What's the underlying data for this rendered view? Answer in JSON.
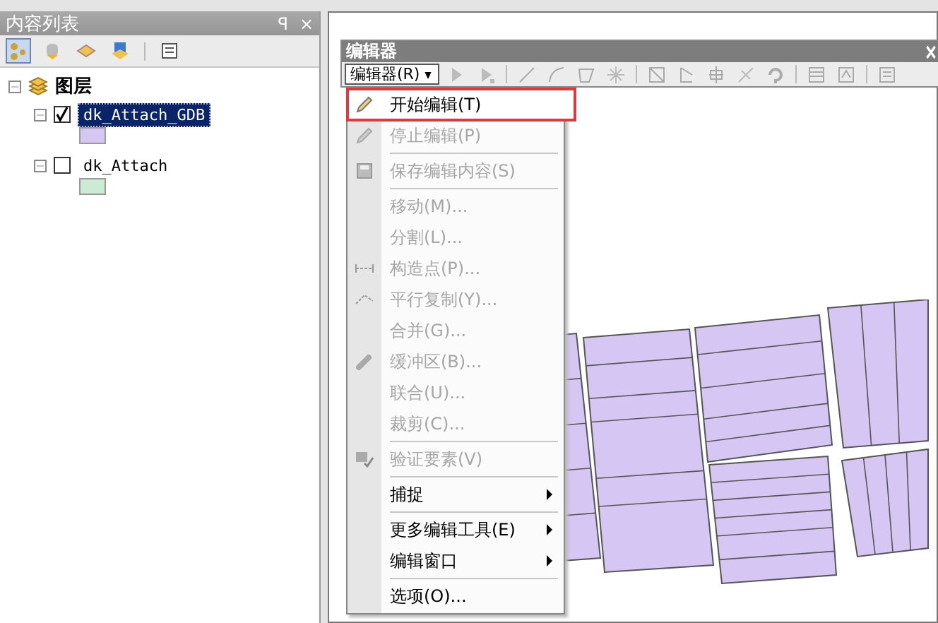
{
  "toc_panel": {
    "title": "内容列表",
    "pin": "ꟼ",
    "close": "×"
  },
  "layer_tree": {
    "label": "图层",
    "expanded": true,
    "children": [
      {
        "label": "dk_Attach_GDB",
        "checked": true,
        "selected": true,
        "expanded": true,
        "color": "#d6c6f2"
      },
      {
        "label": "dk_Attach",
        "checked": false,
        "selected": false,
        "expanded": true,
        "color": "#cdebd4"
      }
    ]
  },
  "editor_toolbar": {
    "title": "编辑器",
    "menu_button": "编辑器(R)"
  },
  "editor_menu": [
    {
      "kind": "item",
      "label": "开始编辑(T)",
      "disabled": false,
      "highlighted": true
    },
    {
      "kind": "item",
      "label": "停止编辑(P)",
      "disabled": true,
      "highlighted": false
    },
    {
      "kind": "separator"
    },
    {
      "kind": "item",
      "label": "保存编辑内容(S)",
      "disabled": true,
      "highlighted": false
    },
    {
      "kind": "separator"
    },
    {
      "kind": "item",
      "label": "移动(M)...",
      "disabled": true,
      "highlighted": false
    },
    {
      "kind": "item",
      "label": "分割(L)...",
      "disabled": true,
      "highlighted": false
    },
    {
      "kind": "item",
      "label": "构造点(P)...",
      "disabled": true,
      "highlighted": false
    },
    {
      "kind": "item",
      "label": "平行复制(Y)...",
      "disabled": true,
      "highlighted": false
    },
    {
      "kind": "item",
      "label": "合并(G)...",
      "disabled": true,
      "highlighted": false
    },
    {
      "kind": "item",
      "label": "缓冲区(B)...",
      "disabled": true,
      "highlighted": false
    },
    {
      "kind": "item",
      "label": "联合(U)...",
      "disabled": true,
      "highlighted": false
    },
    {
      "kind": "item",
      "label": "裁剪(C)...",
      "disabled": true,
      "highlighted": false
    },
    {
      "kind": "separator"
    },
    {
      "kind": "item",
      "label": "验证要素(V)",
      "disabled": true,
      "highlighted": false
    },
    {
      "kind": "separator"
    },
    {
      "kind": "submenu",
      "label": "捕捉",
      "disabled": false,
      "highlighted": false
    },
    {
      "kind": "separator"
    },
    {
      "kind": "submenu",
      "label": "更多编辑工具(E)",
      "disabled": false,
      "highlighted": false
    },
    {
      "kind": "submenu",
      "label": "编辑窗口",
      "disabled": false,
      "highlighted": false
    },
    {
      "kind": "separator"
    },
    {
      "kind": "item",
      "label": "选项(O)...",
      "disabled": false,
      "highlighted": false
    }
  ]
}
